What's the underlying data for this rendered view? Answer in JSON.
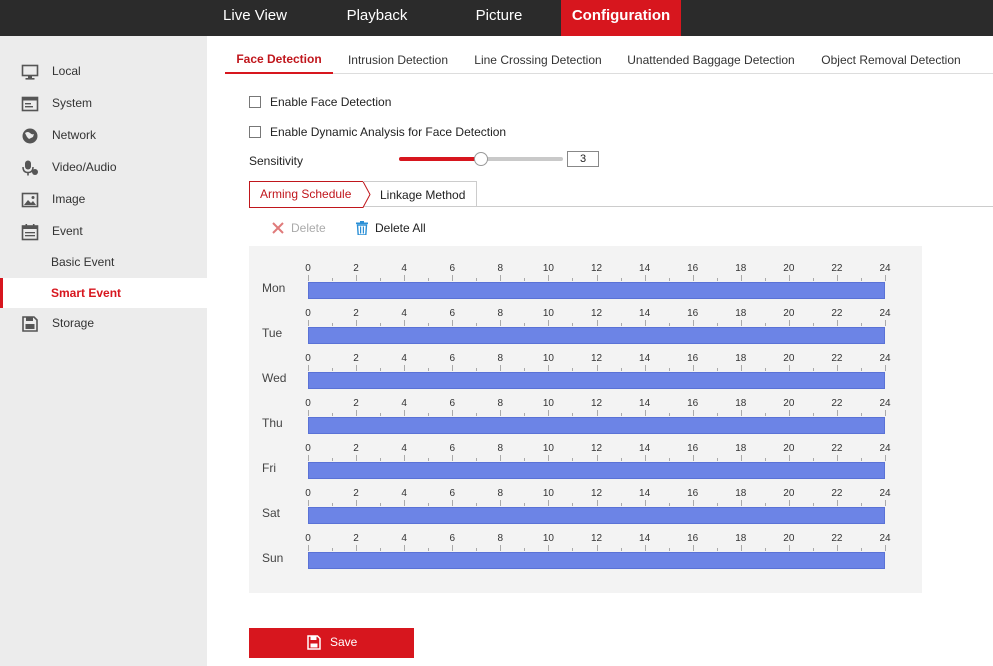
{
  "topnav": {
    "items": [
      {
        "label": "Live View",
        "active": false
      },
      {
        "label": "Playback",
        "active": false
      },
      {
        "label": "Picture",
        "active": false
      },
      {
        "label": "Configuration",
        "active": true
      }
    ]
  },
  "sidebar": {
    "items": [
      {
        "label": "Local",
        "icon": "monitor-icon"
      },
      {
        "label": "System",
        "icon": "system-icon"
      },
      {
        "label": "Network",
        "icon": "network-globe-icon"
      },
      {
        "label": "Video/Audio",
        "icon": "microphone-icon"
      },
      {
        "label": "Image",
        "icon": "image-icon"
      },
      {
        "label": "Event",
        "icon": "calendar-icon"
      },
      {
        "label": "Basic Event",
        "sub": true
      },
      {
        "label": "Smart Event",
        "sub": true,
        "active": true
      },
      {
        "label": "Storage",
        "icon": "storage-icon"
      }
    ]
  },
  "tabs": [
    {
      "label": "Face Detection",
      "active": true
    },
    {
      "label": "Intrusion Detection"
    },
    {
      "label": "Line Crossing Detection"
    },
    {
      "label": "Unattended Baggage Detection"
    },
    {
      "label": "Object Removal Detection"
    }
  ],
  "options": {
    "enable_face_detection": "Enable Face Detection",
    "enable_dynamic_analysis": "Enable Dynamic Analysis for Face Detection"
  },
  "sensitivity": {
    "label": "Sensitivity",
    "value": "3",
    "fraction": 0.5
  },
  "subtabs": {
    "arming_schedule": "Arming Schedule",
    "linkage_method": "Linkage Method"
  },
  "actions": {
    "delete": "Delete",
    "delete_all": "Delete All"
  },
  "schedule": {
    "days": [
      "Mon",
      "Tue",
      "Wed",
      "Thu",
      "Fri",
      "Sat",
      "Sun"
    ],
    "ticks": [
      "0",
      "2",
      "4",
      "6",
      "8",
      "10",
      "12",
      "14",
      "16",
      "18",
      "20",
      "22",
      "24"
    ],
    "bar_color": "#6c84e6"
  },
  "save_label": "Save",
  "colors": {
    "accent": "#d7161e",
    "topbar": "#2b2b2b",
    "sidebar": "#ececec"
  }
}
